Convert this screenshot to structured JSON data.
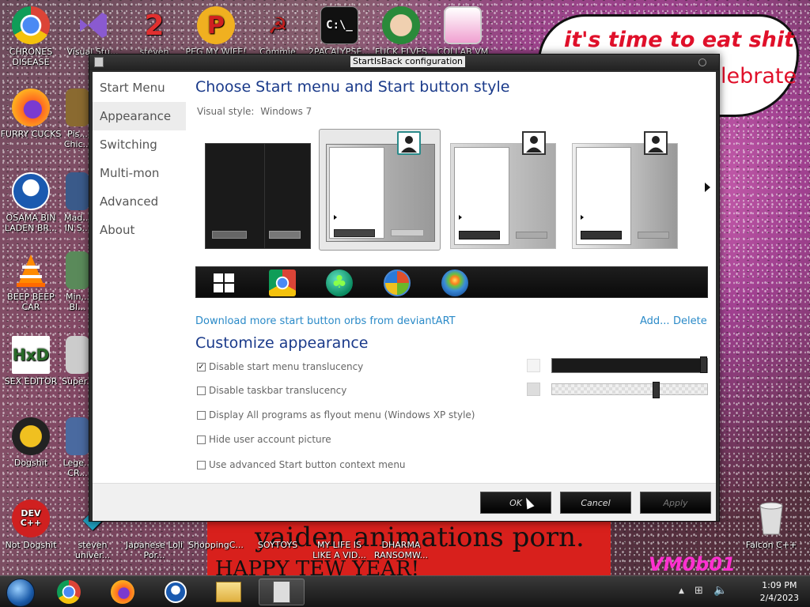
{
  "wallpaper": {
    "bubble_line1": "it's time to eat shit",
    "bubble_line2": "lebrate",
    "banner_line1": "yaiden animations porn.",
    "banner_line2": "HAPPY TEW YEAR!",
    "tag": "VM0b01"
  },
  "desktop_icons": [
    {
      "label": "CHRONES DISEASE",
      "icon": "chrome-icon"
    },
    {
      "label": "Visual Stu...",
      "icon": "visual-studio-icon"
    },
    {
      "label": "steven",
      "icon": "number-2-icon"
    },
    {
      "label": "PEG MY WIFE!",
      "icon": "p-logo-icon"
    },
    {
      "label": "Commie",
      "icon": "commie-icon"
    },
    {
      "label": "2PACALYPSE...",
      "icon": "terminal-icon"
    },
    {
      "label": "FUCK ELVES",
      "icon": "elf-icon"
    },
    {
      "label": "COLLAB VM",
      "icon": "monitor-icon"
    },
    {
      "label": "FURRY CUCKS",
      "icon": "firefox-icon"
    },
    {
      "label": "Pis... Chic...",
      "icon": "app-icon"
    },
    {
      "label": "OSAMA BIN LADEN BR...",
      "icon": "obama-logo-icon"
    },
    {
      "label": "Mad... IN S...",
      "icon": "app-icon"
    },
    {
      "label": "BEEP BEEP CAR",
      "icon": "vlc-icon"
    },
    {
      "label": "Min... Bl...",
      "icon": "app-icon"
    },
    {
      "label": "SEX EDITOR",
      "icon": "hxd-icon"
    },
    {
      "label": "Super...",
      "icon": "app-icon"
    },
    {
      "label": "Dogshit",
      "icon": "codeblocks-icon"
    },
    {
      "label": "Lege... CR...",
      "icon": "app-icon"
    },
    {
      "label": "Not Dogshit",
      "icon": "devcpp-icon"
    },
    {
      "label": "steven univer...",
      "icon": "gem-icon"
    },
    {
      "label": "Japanese Loli Por...",
      "icon": "app-icon"
    },
    {
      "label": "ShoppingC...",
      "icon": "app-icon"
    },
    {
      "label": "SOYTOYS",
      "icon": "app-icon"
    },
    {
      "label": "MY LIFE IS LIKE A VID...",
      "icon": "app-icon"
    },
    {
      "label": "DHARMA RANSOMW...",
      "icon": "app-icon"
    },
    {
      "label": "Falcon C++",
      "icon": "recycle-bin-icon"
    }
  ],
  "window": {
    "title": "StartIsBack configuration",
    "nav": [
      "Start Menu",
      "Appearance",
      "Switching",
      "Multi-mon",
      "Advanced",
      "About"
    ],
    "active_nav": "Appearance",
    "heading1": "Choose Start menu and Start button style",
    "visual_style_label": "Visual style:",
    "visual_style_value": "Windows 7",
    "download_link": "Download more start button orbs from deviantART",
    "add_link": "Add...",
    "delete_link": "Delete",
    "heading2": "Customize appearance",
    "options": [
      {
        "label": "Disable start menu translucency",
        "checked": true
      },
      {
        "label": "Disable taskbar translucency",
        "checked": false
      },
      {
        "label": "Display All programs as flyout menu (Windows XP style)",
        "checked": false
      },
      {
        "label": "Hide user account picture",
        "checked": false
      },
      {
        "label": "Use advanced Start button context menu",
        "checked": false
      }
    ],
    "slider1_level": 1.0,
    "slider2_level": 0.68,
    "buttons": {
      "ok": "OK",
      "cancel": "Cancel",
      "apply": "Apply"
    }
  },
  "taskbar": {
    "time": "1:09 PM",
    "date": "2/4/2023"
  }
}
